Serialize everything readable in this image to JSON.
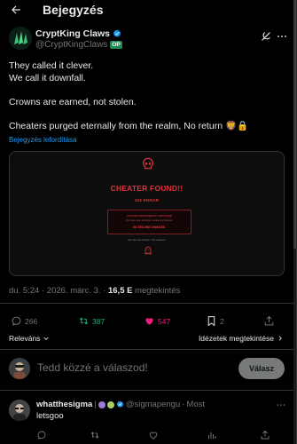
{
  "header": {
    "title": "Bejegyzés"
  },
  "author": {
    "name": "CryptKing Claws",
    "handle": "@CryptKingClaws",
    "badge": "OP"
  },
  "post": {
    "lines": [
      "They called it clever.",
      "We call it downfall.",
      "Crowns are earned, not stolen.",
      "Cheaters purged eternally from the realm, No return 🦁🔒"
    ],
    "translate_label": "Bejegyzés lefordítása"
  },
  "media": {
    "headline": "CHEATER FOUND!!",
    "code": "404 ERROR",
    "warn_title": "ACCESS PERMANENTLY REVOKED",
    "warn_body": "You have been identified, tracked and banned.",
    "warn_final": "NO SECOND CHANCES.",
    "sub": "You had one chance. You wasted it."
  },
  "meta": {
    "time": "du. 5:24",
    "sep1": " · ",
    "date": "2026. márc. 3.",
    "sep2": " · ",
    "views_count": "16,5 E",
    "views_label": "megtekintés"
  },
  "actions": {
    "replies": "266",
    "reposts": "387",
    "likes": "547",
    "bookmarks": "2"
  },
  "sort": {
    "left": "Releváns",
    "right": "Idézetek megtekintése"
  },
  "compose": {
    "placeholder": "Tedd közzé a válaszod!",
    "button": "Válasz"
  },
  "reply": {
    "name": "whatthesigma",
    "sep": "|",
    "handle": "@sigmapengu",
    "dot": "·",
    "time": "Most",
    "text": "letsgoo"
  },
  "colors": {
    "accent": "#1d9bf0",
    "repost": "#00ba7c",
    "like": "#f91880",
    "danger": "#e0353d"
  }
}
